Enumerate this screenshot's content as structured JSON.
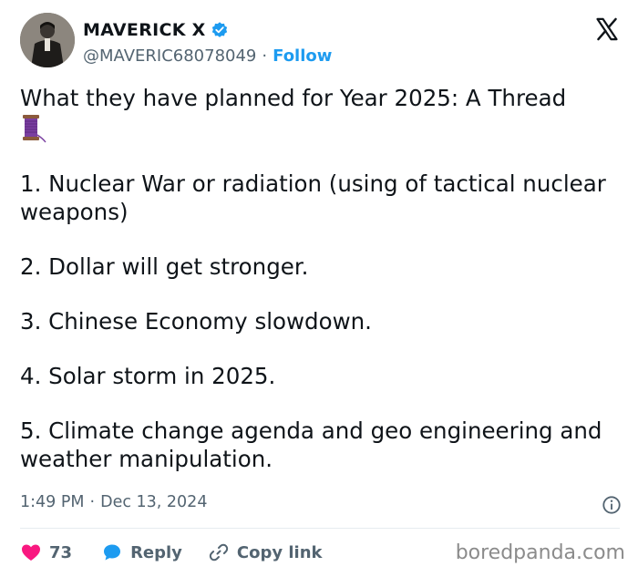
{
  "author": {
    "display_name": "MAVERICK X",
    "handle": "@MAVERIC68078049",
    "separator": "·",
    "follow_label": "Follow",
    "verified_color": "#1d9bf0"
  },
  "post": {
    "title": "What they have planned for Year 2025: A Thread",
    "items": [
      "1. Nuclear War or radiation (using of tactical nuclear weapons)",
      "2. Dollar will get stronger.",
      "3. Chinese Economy slowdown.",
      "4. Solar storm in 2025.",
      "5. Climate change agenda and geo engineering and weather manipulation."
    ]
  },
  "meta": {
    "time": "1:49 PM",
    "separator": "·",
    "date": "Dec 13, 2024"
  },
  "actions": {
    "like_count": "73",
    "reply_label": "Reply",
    "copy_label": "Copy link",
    "like_color": "#f91880",
    "reply_color": "#1d9bf0"
  },
  "watermark": "boredpanda.com"
}
